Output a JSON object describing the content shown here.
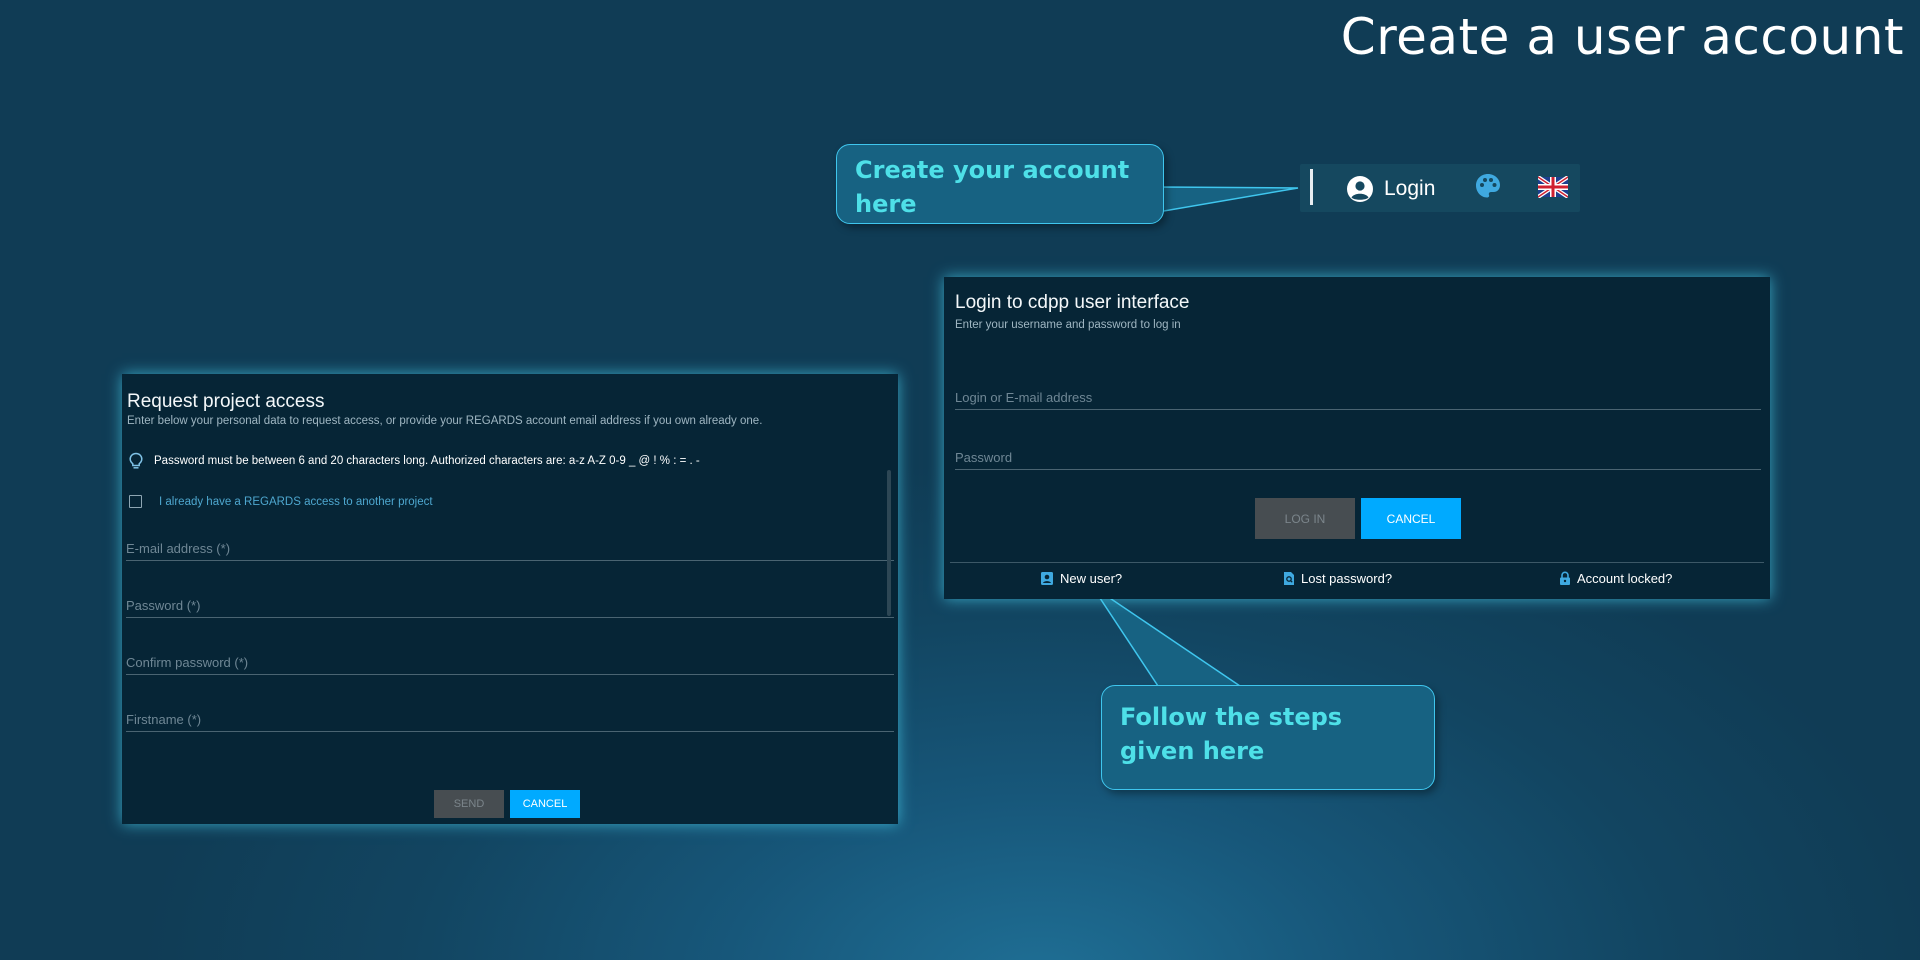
{
  "slide": {
    "title": "Create a user account"
  },
  "navbar": {
    "login_label": "Login",
    "icons": [
      "account-circle-icon",
      "palette-icon",
      "uk-flag-icon"
    ],
    "accent_color": "#3fa9e0"
  },
  "callouts": {
    "create_account": "Create your account here",
    "follow_steps": "Follow the steps given here"
  },
  "request_panel": {
    "title": "Request project access",
    "subtitle": "Enter below your personal data to request access, or provide your REGARDS account email address if you own already one.",
    "password_tip": "Password must be between 6 and 20 characters long. Authorized characters are: a-z A-Z 0-9 _ @ ! % : = . -",
    "existing_access_label": "I already have a REGARDS access to another project",
    "fields": {
      "email": "E-mail address (*)",
      "password": "Password (*)",
      "confirm_password": "Confirm password (*)",
      "firstname": "Firstname (*)"
    },
    "send_label": "SEND",
    "cancel_label": "CANCEL"
  },
  "login_panel": {
    "title": "Login to cdpp user interface",
    "subtitle": "Enter your username and password to log in",
    "fields": {
      "login": "Login or E-mail address",
      "password": "Password"
    },
    "login_label": "LOG IN",
    "cancel_label": "CANCEL",
    "links": {
      "new_user": "New user?",
      "lost_password": "Lost password?",
      "account_locked": "Account locked?"
    }
  },
  "colors": {
    "primary_button": "#00aaff",
    "disabled_button": "#474d51",
    "callout_text": "#4ee0e8",
    "panel_background": "#062536"
  }
}
